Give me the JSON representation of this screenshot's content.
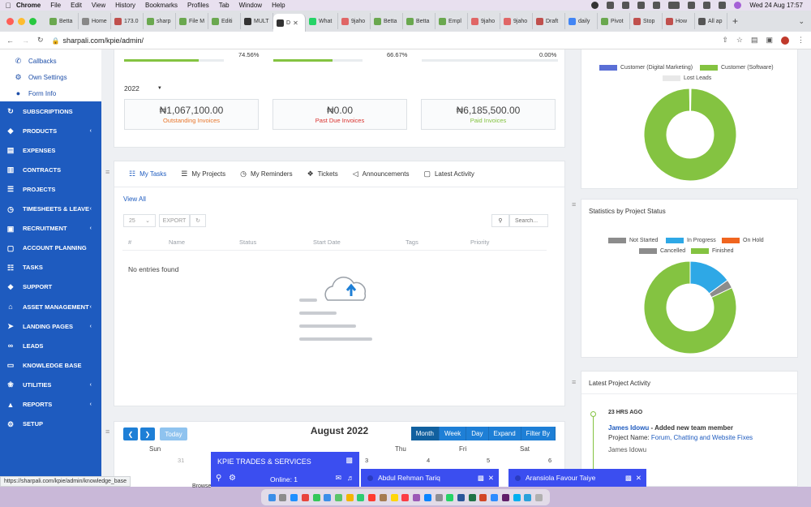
{
  "menubar": {
    "app": "Chrome",
    "items": [
      "File",
      "Edit",
      "View",
      "History",
      "Bookmarks",
      "Profiles",
      "Tab",
      "Window",
      "Help"
    ],
    "clock": "Wed 24 Aug  17:57"
  },
  "tabs": [
    {
      "label": "Betta",
      "color": "#6aa84f"
    },
    {
      "label": "Home",
      "color": "#888888"
    },
    {
      "label": "173.0",
      "color": "#c0504d"
    },
    {
      "label": "sharp",
      "color": "#6aa84f"
    },
    {
      "label": "File M",
      "color": "#6aa84f"
    },
    {
      "label": "Editi",
      "color": "#6aa84f"
    },
    {
      "label": "MULT",
      "color": "#333333"
    },
    {
      "label": "D",
      "color": "#333333",
      "active": true
    },
    {
      "label": "What",
      "color": "#25d366"
    },
    {
      "label": "9jaho",
      "color": "#e06666"
    },
    {
      "label": "Betta",
      "color": "#6aa84f"
    },
    {
      "label": "Betta",
      "color": "#6aa84f"
    },
    {
      "label": "Empl",
      "color": "#6aa84f"
    },
    {
      "label": "9jaho",
      "color": "#e06666"
    },
    {
      "label": "9jaho",
      "color": "#e06666"
    },
    {
      "label": "Draft",
      "color": "#c0504d"
    },
    {
      "label": "daily",
      "color": "#4285f4"
    },
    {
      "label": "Pivot",
      "color": "#6aa84f"
    },
    {
      "label": "Stop",
      "color": "#c0504d"
    },
    {
      "label": "How",
      "color": "#c0504d"
    },
    {
      "label": "All ap",
      "color": "#555555"
    }
  ],
  "address": {
    "url": "sharpali.com/kpie/admin/"
  },
  "sidebar": {
    "sub_items": [
      {
        "label": "Callbacks",
        "icon": "phone-icon"
      },
      {
        "label": "Own Settings",
        "icon": "gear-icon"
      },
      {
        "label": "Form Info",
        "icon": "location-icon"
      }
    ],
    "items": [
      {
        "label": "SUBSCRIPTIONS",
        "icon": "refresh-icon",
        "chevron": false
      },
      {
        "label": "PRODUCTS",
        "icon": "tag-icon",
        "chevron": true
      },
      {
        "label": "EXPENSES",
        "icon": "file-icon",
        "chevron": false
      },
      {
        "label": "CONTRACTS",
        "icon": "contract-icon",
        "chevron": false
      },
      {
        "label": "PROJECTS",
        "icon": "list-icon",
        "chevron": false
      },
      {
        "label": "TIMESHEETS & LEAVE",
        "icon": "clock-icon",
        "chevron": true
      },
      {
        "label": "RECRUITMENT",
        "icon": "id-card-icon",
        "chevron": true
      },
      {
        "label": "ACCOUNT PLANNING",
        "icon": "window-icon",
        "chevron": false
      },
      {
        "label": "TASKS",
        "icon": "tasks-icon",
        "chevron": false
      },
      {
        "label": "SUPPORT",
        "icon": "ticket-icon",
        "chevron": false
      },
      {
        "label": "ASSET MANAGEMENT",
        "icon": "bank-icon",
        "chevron": true
      },
      {
        "label": "LANDING PAGES",
        "icon": "send-icon",
        "chevron": true
      },
      {
        "label": "LEADS",
        "icon": "link-icon",
        "chevron": false
      },
      {
        "label": "KNOWLEDGE BASE",
        "icon": "folder-icon",
        "chevron": false
      },
      {
        "label": "UTILITIES",
        "icon": "gift-icon",
        "chevron": true
      },
      {
        "label": "REPORTS",
        "icon": "chart-icon",
        "chevron": true
      },
      {
        "label": "SETUP",
        "icon": "gear-icon",
        "chevron": false
      }
    ]
  },
  "stats": {
    "progress": [
      {
        "percent_label": "74.56%",
        "value": 74.56
      },
      {
        "percent_label": "66.67%",
        "value": 66.67
      },
      {
        "percent_label": "0.00%",
        "value": 0
      }
    ],
    "year": "2022",
    "invoices": [
      {
        "amount": "₦1,067,100.00",
        "label": "Outstanding Invoices",
        "color": "#e8762b"
      },
      {
        "amount": "₦0.00",
        "label": "Past Due Invoices",
        "color": "#d9302c"
      },
      {
        "amount": "₦6,185,500.00",
        "label": "Paid Invoices",
        "color": "#84c341"
      }
    ]
  },
  "tasks": {
    "tabs": [
      {
        "label": "My Tasks",
        "icon": "tasks-icon",
        "active": true
      },
      {
        "label": "My Projects",
        "icon": "list-icon"
      },
      {
        "label": "My Reminders",
        "icon": "clock-icon"
      },
      {
        "label": "Tickets",
        "icon": "ticket-icon"
      },
      {
        "label": "Announcements",
        "icon": "megaphone-icon"
      },
      {
        "label": "Latest Activity",
        "icon": "window-icon"
      }
    ],
    "view_all": "View All",
    "page_size": "25",
    "export_label": "EXPORT",
    "search_placeholder": "Search...",
    "columns": [
      "#",
      "Name",
      "Status",
      "Start Date",
      "Tags",
      "Priority"
    ],
    "empty_text": "No entries found"
  },
  "calendar": {
    "today_label": "Today",
    "title": "August 2022",
    "views": [
      "Month",
      "Week",
      "Day",
      "Expand",
      "Filter By"
    ],
    "active_view": "Month",
    "day_names": [
      "Sun",
      "Thu",
      "Fri",
      "Sat"
    ],
    "day_nums": [
      "31",
      "3",
      "4",
      "5",
      "6"
    ],
    "browse_label": "Browse"
  },
  "leads_chart": {
    "legend": [
      {
        "label": "Customer (Digital Marketing)",
        "color": "#5a6fd6"
      },
      {
        "label": "Customer (Software)",
        "color": "#84c341"
      },
      {
        "label": "Lost Leads",
        "color": "#e8e8e8"
      }
    ],
    "slices": [
      {
        "value": 0.3,
        "color": "#5a6fd6"
      },
      {
        "value": 99.5,
        "color": "#84c341"
      },
      {
        "value": 0.2,
        "color": "#e8e8e8"
      }
    ]
  },
  "project_status": {
    "title": "Statistics by Project Status",
    "legend": [
      {
        "label": "Not Started",
        "color": "#8c8c8c"
      },
      {
        "label": "In Progress",
        "color": "#2ea8e6"
      },
      {
        "label": "On Hold",
        "color": "#f0651f"
      },
      {
        "label": "Cancelled",
        "color": "#8c8c8c"
      },
      {
        "label": "Finished",
        "color": "#84c341"
      }
    ],
    "slices": [
      {
        "value": 15,
        "color": "#2ea8e6"
      },
      {
        "value": 3,
        "color": "#8c8c8c"
      },
      {
        "value": 82,
        "color": "#84c341"
      }
    ]
  },
  "activity": {
    "title": "Latest Project Activity",
    "time": "23 HRS AGO",
    "actor": "James Idowu",
    "action": " - Added new team member",
    "project_prefix": "Project Name: ",
    "project": "Forum, Chatting and Website Fixes",
    "member": "James Idowu"
  },
  "chat": {
    "main_title": "KPIE TRADES & SERVICES",
    "online": "Online: 1",
    "windows": [
      "Abdul Rehman Tariq",
      "Aransiola Favour Taiye"
    ]
  },
  "status_url": "https://sharpali.com/kpie/admin/knowledge_base"
}
